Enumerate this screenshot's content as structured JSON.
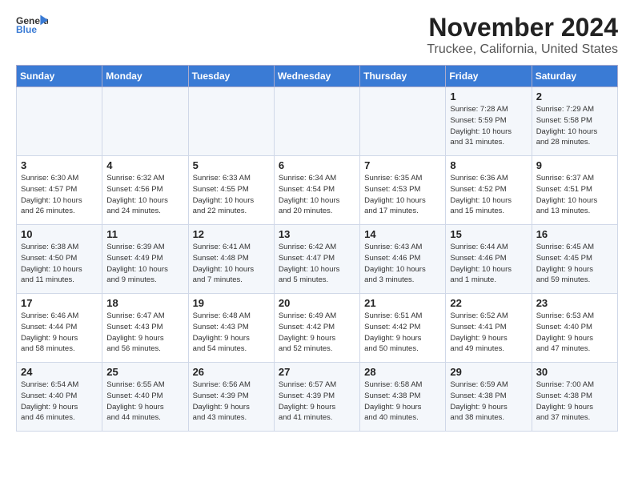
{
  "header": {
    "logo_general": "General",
    "logo_blue": "Blue",
    "month": "November 2024",
    "location": "Truckee, California, United States"
  },
  "days_of_week": [
    "Sunday",
    "Monday",
    "Tuesday",
    "Wednesday",
    "Thursday",
    "Friday",
    "Saturday"
  ],
  "weeks": [
    [
      {
        "day": "",
        "info": ""
      },
      {
        "day": "",
        "info": ""
      },
      {
        "day": "",
        "info": ""
      },
      {
        "day": "",
        "info": ""
      },
      {
        "day": "",
        "info": ""
      },
      {
        "day": "1",
        "info": "Sunrise: 7:28 AM\nSunset: 5:59 PM\nDaylight: 10 hours\nand 31 minutes."
      },
      {
        "day": "2",
        "info": "Sunrise: 7:29 AM\nSunset: 5:58 PM\nDaylight: 10 hours\nand 28 minutes."
      }
    ],
    [
      {
        "day": "3",
        "info": "Sunrise: 6:30 AM\nSunset: 4:57 PM\nDaylight: 10 hours\nand 26 minutes."
      },
      {
        "day": "4",
        "info": "Sunrise: 6:32 AM\nSunset: 4:56 PM\nDaylight: 10 hours\nand 24 minutes."
      },
      {
        "day": "5",
        "info": "Sunrise: 6:33 AM\nSunset: 4:55 PM\nDaylight: 10 hours\nand 22 minutes."
      },
      {
        "day": "6",
        "info": "Sunrise: 6:34 AM\nSunset: 4:54 PM\nDaylight: 10 hours\nand 20 minutes."
      },
      {
        "day": "7",
        "info": "Sunrise: 6:35 AM\nSunset: 4:53 PM\nDaylight: 10 hours\nand 17 minutes."
      },
      {
        "day": "8",
        "info": "Sunrise: 6:36 AM\nSunset: 4:52 PM\nDaylight: 10 hours\nand 15 minutes."
      },
      {
        "day": "9",
        "info": "Sunrise: 6:37 AM\nSunset: 4:51 PM\nDaylight: 10 hours\nand 13 minutes."
      }
    ],
    [
      {
        "day": "10",
        "info": "Sunrise: 6:38 AM\nSunset: 4:50 PM\nDaylight: 10 hours\nand 11 minutes."
      },
      {
        "day": "11",
        "info": "Sunrise: 6:39 AM\nSunset: 4:49 PM\nDaylight: 10 hours\nand 9 minutes."
      },
      {
        "day": "12",
        "info": "Sunrise: 6:41 AM\nSunset: 4:48 PM\nDaylight: 10 hours\nand 7 minutes."
      },
      {
        "day": "13",
        "info": "Sunrise: 6:42 AM\nSunset: 4:47 PM\nDaylight: 10 hours\nand 5 minutes."
      },
      {
        "day": "14",
        "info": "Sunrise: 6:43 AM\nSunset: 4:46 PM\nDaylight: 10 hours\nand 3 minutes."
      },
      {
        "day": "15",
        "info": "Sunrise: 6:44 AM\nSunset: 4:46 PM\nDaylight: 10 hours\nand 1 minute."
      },
      {
        "day": "16",
        "info": "Sunrise: 6:45 AM\nSunset: 4:45 PM\nDaylight: 9 hours\nand 59 minutes."
      }
    ],
    [
      {
        "day": "17",
        "info": "Sunrise: 6:46 AM\nSunset: 4:44 PM\nDaylight: 9 hours\nand 58 minutes."
      },
      {
        "day": "18",
        "info": "Sunrise: 6:47 AM\nSunset: 4:43 PM\nDaylight: 9 hours\nand 56 minutes."
      },
      {
        "day": "19",
        "info": "Sunrise: 6:48 AM\nSunset: 4:43 PM\nDaylight: 9 hours\nand 54 minutes."
      },
      {
        "day": "20",
        "info": "Sunrise: 6:49 AM\nSunset: 4:42 PM\nDaylight: 9 hours\nand 52 minutes."
      },
      {
        "day": "21",
        "info": "Sunrise: 6:51 AM\nSunset: 4:42 PM\nDaylight: 9 hours\nand 50 minutes."
      },
      {
        "day": "22",
        "info": "Sunrise: 6:52 AM\nSunset: 4:41 PM\nDaylight: 9 hours\nand 49 minutes."
      },
      {
        "day": "23",
        "info": "Sunrise: 6:53 AM\nSunset: 4:40 PM\nDaylight: 9 hours\nand 47 minutes."
      }
    ],
    [
      {
        "day": "24",
        "info": "Sunrise: 6:54 AM\nSunset: 4:40 PM\nDaylight: 9 hours\nand 46 minutes."
      },
      {
        "day": "25",
        "info": "Sunrise: 6:55 AM\nSunset: 4:40 PM\nDaylight: 9 hours\nand 44 minutes."
      },
      {
        "day": "26",
        "info": "Sunrise: 6:56 AM\nSunset: 4:39 PM\nDaylight: 9 hours\nand 43 minutes."
      },
      {
        "day": "27",
        "info": "Sunrise: 6:57 AM\nSunset: 4:39 PM\nDaylight: 9 hours\nand 41 minutes."
      },
      {
        "day": "28",
        "info": "Sunrise: 6:58 AM\nSunset: 4:38 PM\nDaylight: 9 hours\nand 40 minutes."
      },
      {
        "day": "29",
        "info": "Sunrise: 6:59 AM\nSunset: 4:38 PM\nDaylight: 9 hours\nand 38 minutes."
      },
      {
        "day": "30",
        "info": "Sunrise: 7:00 AM\nSunset: 4:38 PM\nDaylight: 9 hours\nand 37 minutes."
      }
    ]
  ]
}
